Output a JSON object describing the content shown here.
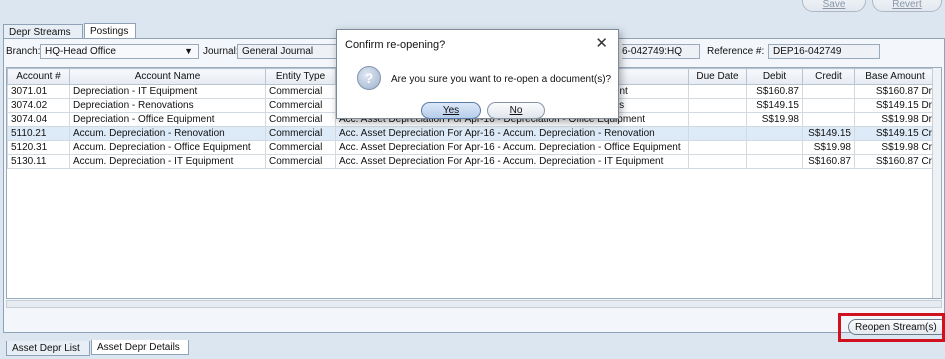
{
  "toolbar": {
    "save_label": "Save",
    "revert_label": "Revert"
  },
  "tabs": {
    "depr_streams": "Depr Streams",
    "postings": "Postings"
  },
  "header": {
    "branch_label": "Branch:",
    "branch_value": "HQ-Head Office",
    "journal_label": "Journal:",
    "journal_value": "General Journal",
    "doc_value": "6-042749:HQ",
    "reference_label": "Reference #:",
    "reference_value": "DEP16-042749"
  },
  "grid": {
    "columns": [
      "Account #",
      "Account Name",
      "Entity Type",
      "",
      "Due Date",
      "Debit",
      "Credit",
      "Base Amount"
    ],
    "rows": [
      [
        "3071.01",
        "Depreciation - IT Equipment",
        "Commercial",
        "Acc. Asset Depreciation For Apr-16 - Depreciation - IT Equipment",
        "",
        "S$160.87",
        "",
        "S$160.87 Dr"
      ],
      [
        "3074.02",
        "Depreciation - Renovations",
        "Commercial",
        "Acc. Asset Depreciation For Apr-16 - Depreciation - Renovations",
        "",
        "S$149.15",
        "",
        "S$149.15 Dr"
      ],
      [
        "3074.04",
        "Depreciation - Office Equipment",
        "Commercial",
        "Acc. Asset Depreciation For Apr-16 - Depreciation - Office Equipment",
        "",
        "S$19.98",
        "",
        "S$19.98 Dr"
      ],
      [
        "5110.21",
        "Accum. Depreciation - Renovation",
        "Commercial",
        "Acc. Asset Depreciation For Apr-16 - Accum. Depreciation - Renovation",
        "",
        "",
        "S$149.15",
        "S$149.15 Cr"
      ],
      [
        "5120.31",
        "Accum. Depreciation - Office Equipment",
        "Commercial",
        "Acc. Asset Depreciation For Apr-16 - Accum. Depreciation - Office Equipment",
        "",
        "",
        "S$19.98",
        "S$19.98 Cr"
      ],
      [
        "5130.11",
        "Accum. Depreciation - IT Equipment",
        "Commercial",
        "Acc. Asset Depreciation For Apr-16 - Accum. Depreciation - IT Equipment",
        "",
        "",
        "S$160.87",
        "S$160.87 Cr"
      ]
    ]
  },
  "dialog": {
    "title": "Confirm re-opening?",
    "message": "Are you sure you want to re-open a document(s)?",
    "yes_label": "Yes",
    "no_label": "No",
    "close_glyph": "✕",
    "icon_glyph": "?"
  },
  "footer": {
    "reopen_label": "Reopen Stream(s)",
    "tab_list": "Asset Depr List",
    "tab_details": "Asset Depr Details"
  },
  "colors": {
    "highlight": "#d0121f",
    "window_bg": "#dce6f0"
  }
}
